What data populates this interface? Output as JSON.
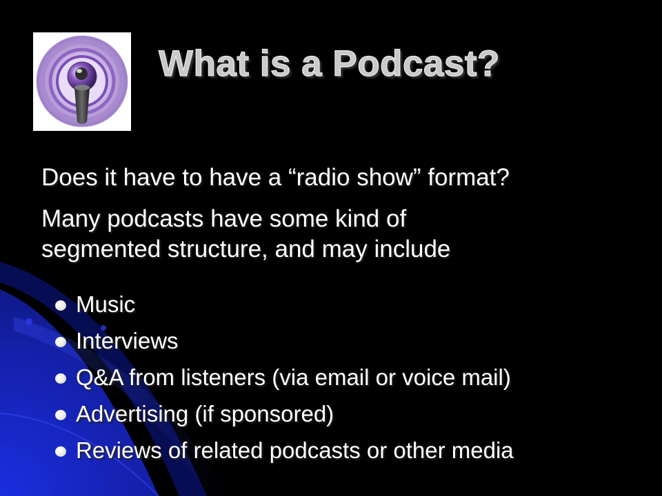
{
  "slide": {
    "title": "What is a Podcast?",
    "icon": "podcast-icon",
    "paragraphs": [
      "Does it have to have a “radio show” format?",
      "Many podcasts have some kind of",
      "segmented structure, and may include"
    ],
    "bullets": [
      "Music",
      "Interviews",
      "Q&A from listeners (via email or voice mail)",
      "Advertising (if sponsored)",
      "Reviews of related podcasts or other media"
    ]
  },
  "colors": {
    "background": "#000000",
    "accent_blue": "#1a2ad0",
    "title": "#c9c9c9",
    "text": "#ffffff",
    "icon_purple": "#8e5fc8"
  }
}
